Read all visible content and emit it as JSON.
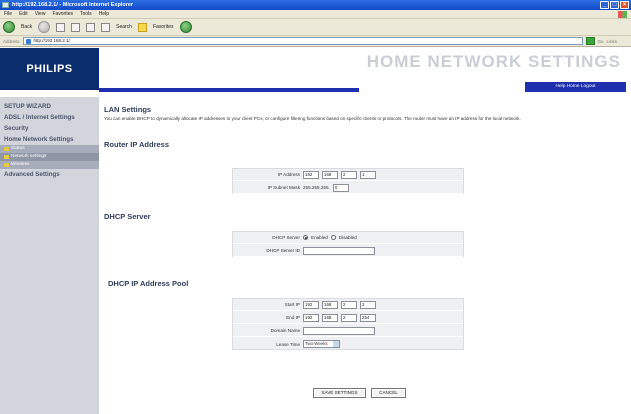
{
  "window": {
    "title": "http://192.168.2.1/ - Microsoft Internet Explorer",
    "menu": [
      "File",
      "Edit",
      "View",
      "Favorites",
      "Tools",
      "Help"
    ],
    "toolbar": {
      "back_label": "Back",
      "search_label": "Search",
      "favorites_label": "Favorites"
    },
    "address": {
      "label": "Address",
      "value": "http://192.168.2.1/",
      "go_label": "Go",
      "links_label": "Links"
    }
  },
  "header": {
    "logo": "PHILIPS",
    "title": "HOME NETWORK SETTINGS",
    "help_links": "Help  Home  Logout"
  },
  "sidebar": {
    "items": [
      {
        "label": "SETUP WIZARD"
      },
      {
        "label": "ADSL / Internet Settings"
      },
      {
        "label": "Security"
      },
      {
        "label": "Home Network Settings"
      }
    ],
    "subitems": [
      {
        "label": "Status"
      },
      {
        "label": "Network settings"
      },
      {
        "label": "Wireless"
      }
    ],
    "advanced": "Advanced Settings"
  },
  "main": {
    "section_title": "LAN Settings",
    "description": "You can enable DHCP to dynamically allocate IP addresses to your client PCs, or configure filtering functions based on specific clients or protocols. The router must have an IP address for the local network.",
    "router_ip": {
      "heading": "Router IP Address",
      "ip_label": "IP Address",
      "ip": [
        "192",
        "168",
        "2",
        "1"
      ],
      "mask_label": "IP Subnet Mask",
      "mask_prefix": "255.255.255.",
      "mask_last": "0"
    },
    "dhcp_server": {
      "heading": "DHCP Server",
      "server_label": "DHCP Server",
      "enabled_label": "Enabled",
      "disabled_label": "Disabled",
      "server_id_label": "DHCP Server ID",
      "server_id_value": ""
    },
    "dhcp_pool": {
      "heading": "DHCP IP Address Pool",
      "start_label": "Start IP",
      "start": [
        "192",
        "168",
        "2",
        "2"
      ],
      "end_label": "End IP",
      "end": [
        "192",
        "168",
        "2",
        "254"
      ],
      "domain_label": "Domain Name",
      "domain_value": "",
      "lease_label": "Lease Time",
      "lease_value": "Two Weeks"
    },
    "buttons": {
      "save": "SAVE SETTINGS",
      "cancel": "CANCEL"
    }
  }
}
